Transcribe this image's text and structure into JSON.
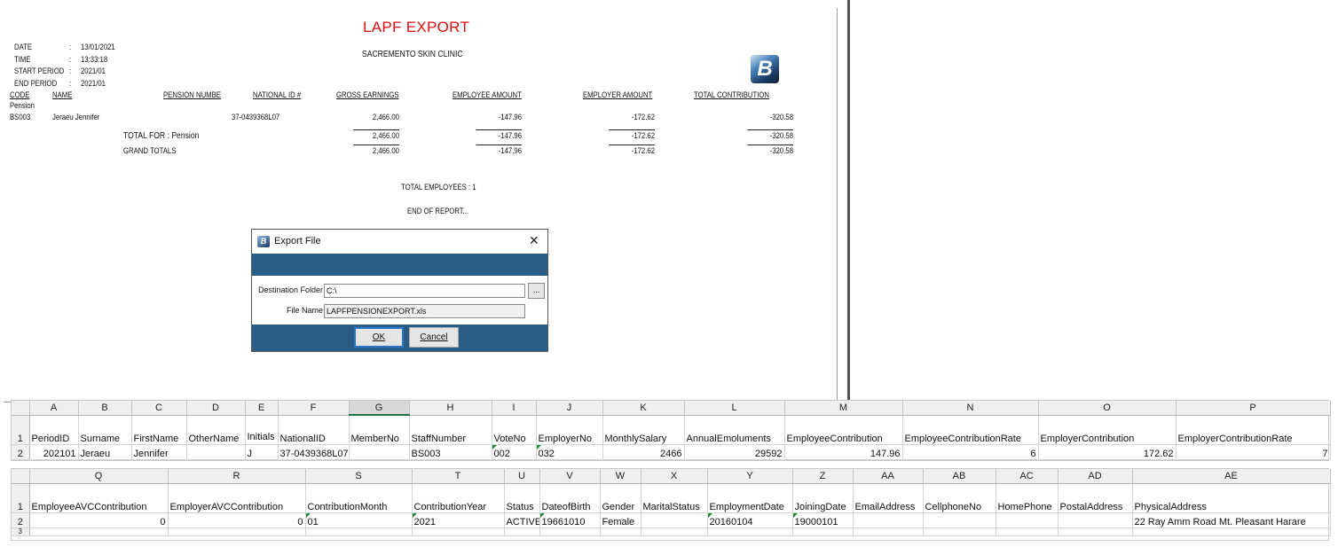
{
  "report": {
    "title": "LAPF EXPORT",
    "company": "SACREMENTO SKIN CLINIC",
    "logo_letter": "B",
    "meta": [
      {
        "label": "DATE",
        "sep": ":",
        "value": "13/01/2021"
      },
      {
        "label": "TIME",
        "sep": ":",
        "value": "13:33:18"
      },
      {
        "label": "START PERIOD",
        "sep": ":",
        "value": "2021/01"
      },
      {
        "label": "END PERIOD",
        "sep": ":",
        "value": "2021/01"
      }
    ],
    "columns": {
      "code": "CODE",
      "name": "NAME",
      "pension": "PENSION NUMBE",
      "national": "NATIONAL ID #",
      "gross": "GROSS EARNINGS",
      "employee": "EMPLOYEE AMOUNT",
      "employer": "EMPLOYER AMOUNT",
      "total": "TOTAL CONTRIBUTION"
    },
    "group": "Pension",
    "row": {
      "code": "BS003",
      "name": "Jeraeu Jennifer",
      "national": "37-0439368L07",
      "gross": "2,466.00",
      "employee": "-147.96",
      "employer": "-172.62",
      "total": "-320.58"
    },
    "total_for": {
      "label": "TOTAL FOR : Pension",
      "gross": "2,466.00",
      "employee": "-147.96",
      "employer": "-172.62",
      "total": "-320.58"
    },
    "grand": {
      "label": "GRAND TOTALS",
      "gross": "2,466.00",
      "employee": "-147.96",
      "employer": "-172.62",
      "total": "-320.58"
    },
    "total_employees": "TOTAL EMPLOYEES : 1",
    "end": "END OF REPORT..."
  },
  "dialog": {
    "title": "Export File",
    "close": "✕",
    "dest_label": "Destination Folder",
    "dest_value": "C:\\",
    "browse": "...",
    "file_label": "File Name",
    "file_value": "LAPFPENSIONEXPORT.xls",
    "ok": "OK",
    "cancel": "Cancel"
  },
  "sheet1": {
    "cols": [
      "A",
      "B",
      "C",
      "D",
      "E",
      "F",
      "G",
      "H",
      "I",
      "J",
      "K",
      "L",
      "M",
      "N",
      "O",
      "P"
    ],
    "headers": [
      "PeriodID",
      "Surname",
      "FirstName",
      "OtherName",
      "Initials",
      "NationalID",
      "MemberNo",
      "StaffNumber",
      "VoteNo",
      "EmployerNo",
      "MonthlySalary",
      "AnnualEmoluments",
      "EmployeeContribution",
      "EmployeeContributionRate",
      "EmployerContribution",
      "EmployerContributionRate"
    ],
    "values": [
      "202101",
      "Jeraeu",
      "Jennifer",
      "",
      "J",
      "37-0439368L07",
      "",
      "BS003",
      "002",
      "032",
      "2466",
      "29592",
      "147.96",
      "6",
      "172.62",
      "7"
    ]
  },
  "sheet2": {
    "cols": [
      "Q",
      "R",
      "S",
      "T",
      "U",
      "V",
      "W",
      "X",
      "Y",
      "Z",
      "AA",
      "AB",
      "AC",
      "AD",
      "AE"
    ],
    "headers": [
      "EmployeeAVCContribution",
      "EmployerAVCContribution",
      "ContributionMonth",
      "ContributionYear",
      "Status",
      "DateofBirth",
      "Gender",
      "MaritalStatus",
      "EmploymentDate",
      "JoiningDate",
      "EmailAddress",
      "CellphoneNo",
      "HomePhone",
      "PostalAddress",
      "PhysicalAddress"
    ],
    "values": [
      "0",
      "0",
      "01",
      "2021",
      "ACTIVE",
      "19661010",
      "Female",
      "",
      "20160104",
      "19000101",
      "",
      "",
      "",
      "",
      "22 Ray Amm Road Mt. Pleasant  Harare"
    ]
  },
  "row_numbers": [
    "1",
    "2",
    "3"
  ]
}
